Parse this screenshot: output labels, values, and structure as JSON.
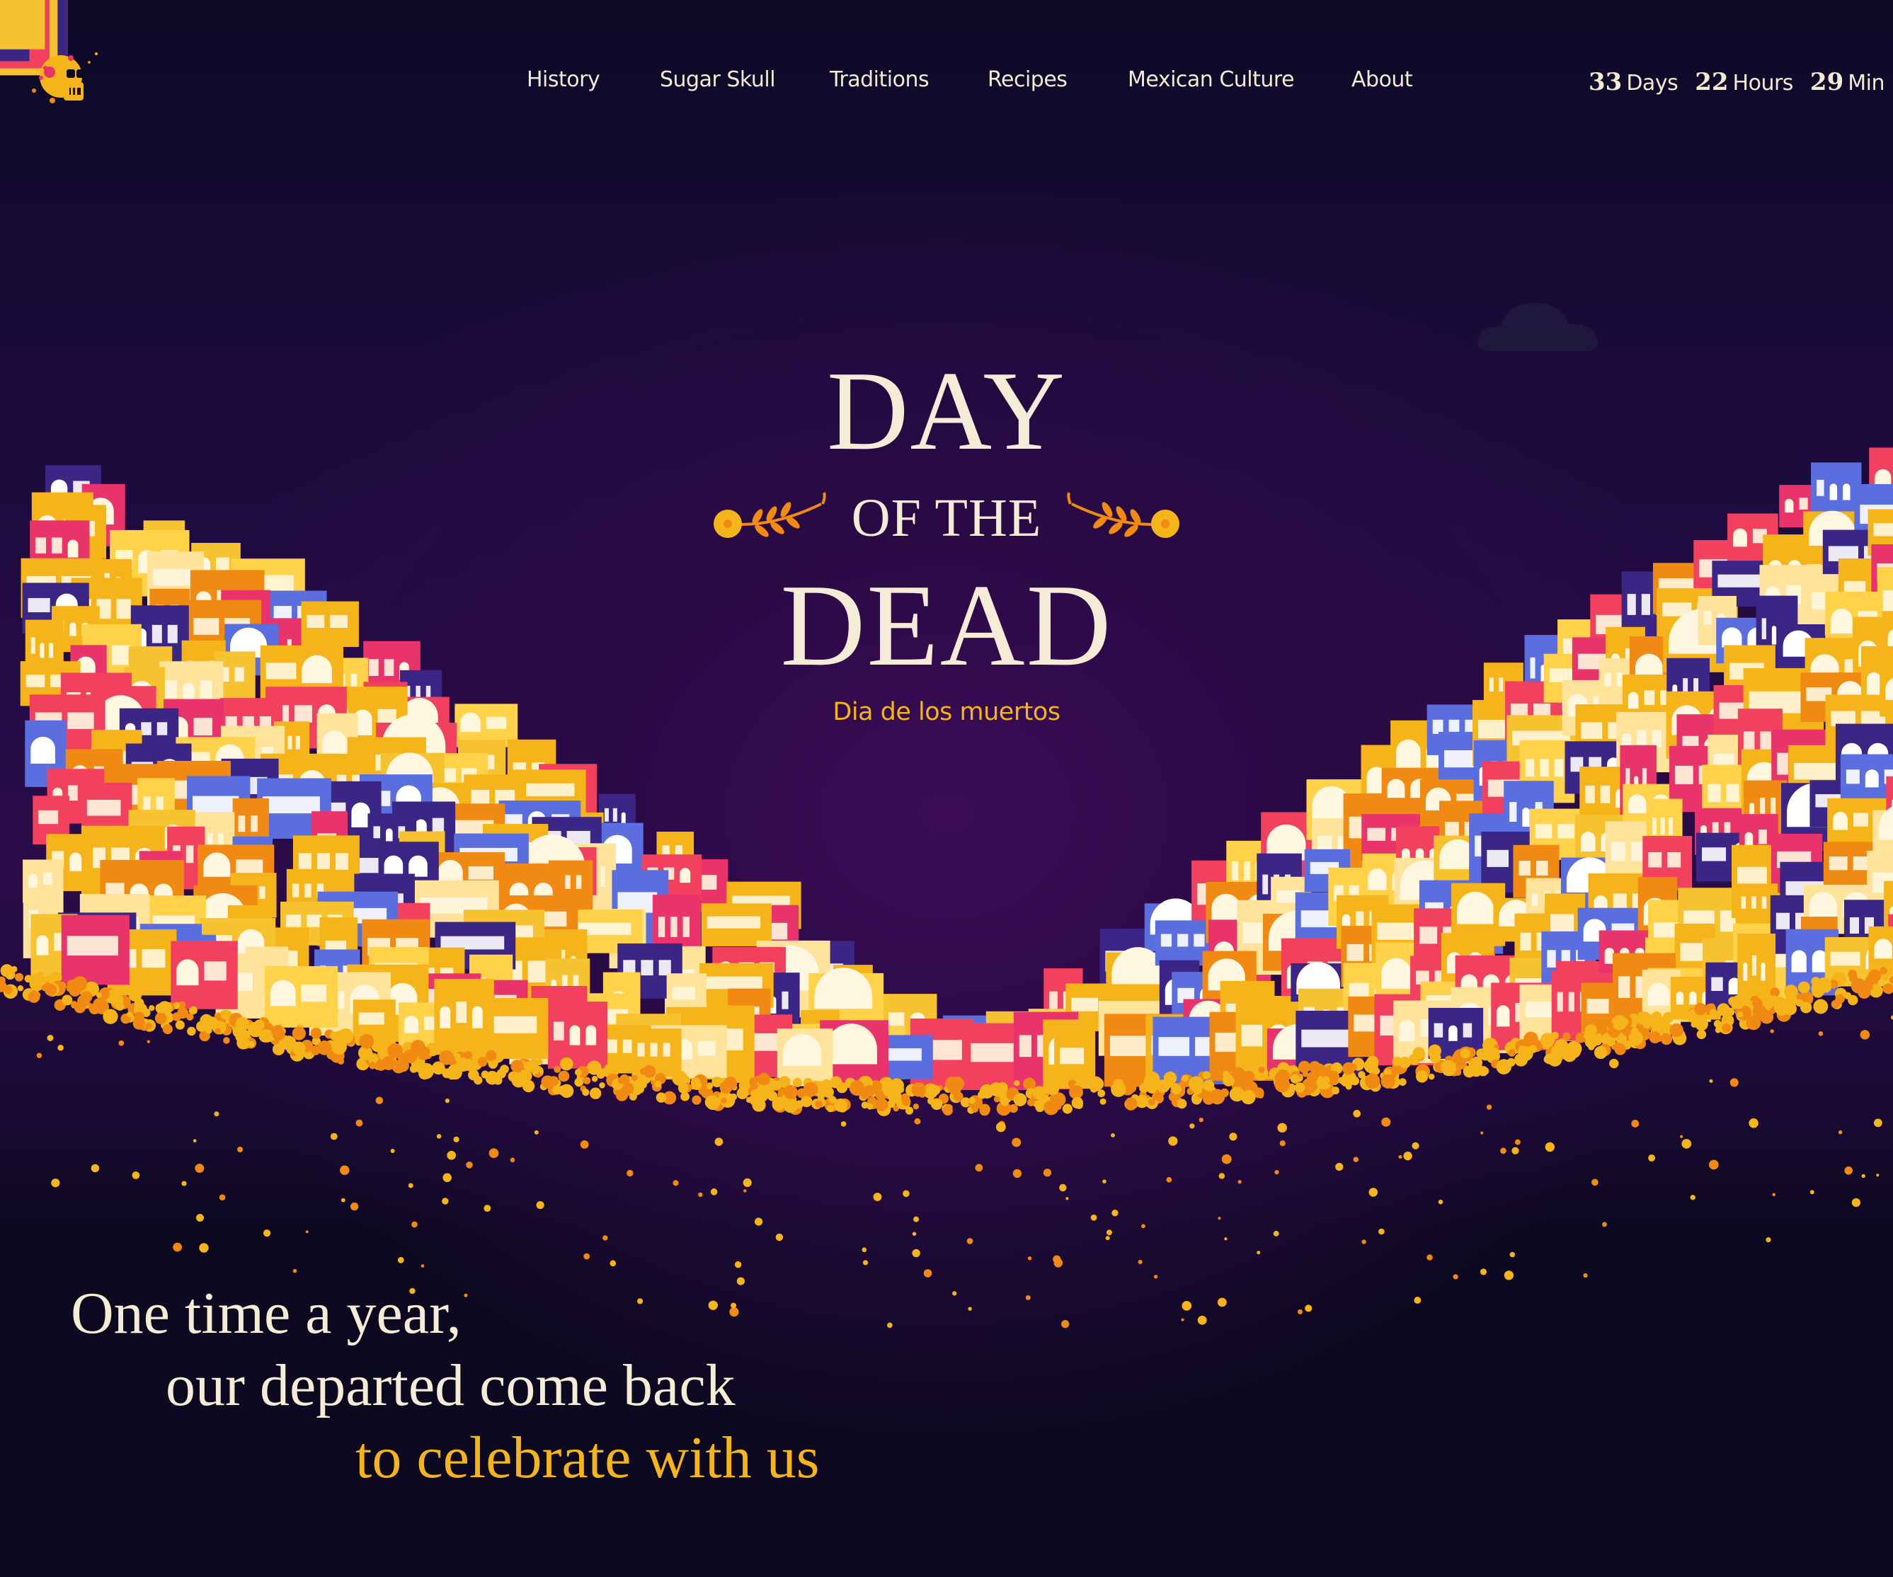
{
  "nav": {
    "items": [
      "History",
      "Sugar Skull",
      "Traditions",
      "Recipes",
      "Mexican Culture",
      "About"
    ]
  },
  "countdown": {
    "days": "33",
    "days_label": "Days",
    "hours": "22",
    "hours_label": "Hours",
    "minutes": "29",
    "minutes_label": "Min"
  },
  "hero": {
    "title_line1": "DAY",
    "title_line2": "OF THE",
    "title_line3": "DEAD",
    "subtitle": "Dia de los muertos"
  },
  "tagline": {
    "line1": "One time a year,",
    "line2": "our departed come back",
    "line3": "to celebrate with us"
  },
  "colors": {
    "background": "#0d0920",
    "sky_glow": "#3c0c58",
    "cream": "#f4ecd6",
    "marigold": "#f5b51a",
    "orange": "#f08a12",
    "pink": "#e8336b",
    "blue": "#5a6ee0",
    "purple": "#3b2585"
  },
  "icons": [
    "sugar-skull-logo-icon",
    "marigold-sprig-icon",
    "cloud-icon"
  ]
}
